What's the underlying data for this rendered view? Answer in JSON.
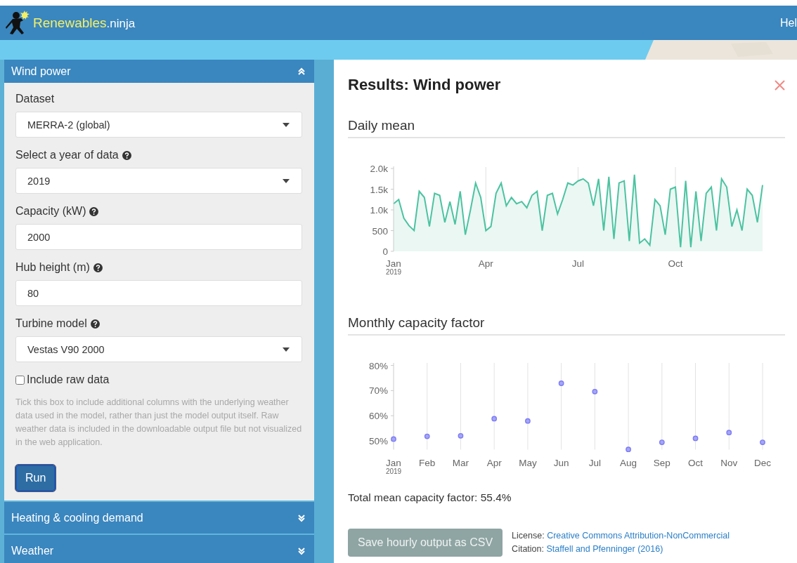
{
  "header": {
    "brand": "Renewables",
    "brand_suffix": ".ninja",
    "nav": [
      "Hel"
    ]
  },
  "sidebar": {
    "sections": [
      {
        "title": "Wind power",
        "expanded": true
      },
      {
        "title": "Heating & cooling demand",
        "expanded": false
      },
      {
        "title": "Weather",
        "expanded": false
      }
    ],
    "fields": [
      {
        "kind": "select",
        "label": "Dataset",
        "help": false,
        "value": "MERRA-2 (global)"
      },
      {
        "kind": "select",
        "label": "Select a year of data",
        "help": true,
        "value": "2019"
      },
      {
        "kind": "text",
        "label": "Capacity (kW)",
        "help": true,
        "value": "2000"
      },
      {
        "kind": "text",
        "label": "Hub height (m)",
        "help": true,
        "value": "80"
      },
      {
        "kind": "select",
        "label": "Turbine model",
        "help": true,
        "value": "Vestas V90 2000"
      }
    ],
    "checkbox": {
      "label": "Include raw data",
      "checked": false
    },
    "hint": "Tick this box to include additional columns with the underlying weather data used in the model, rather than just the model output itself. Raw weather data is included in the downloadable output file but not visualized in the web application.",
    "run_button": "Run"
  },
  "results": {
    "title": "Results: Wind power",
    "daily": {
      "title": "Daily mean",
      "year_label": "2019",
      "chart_data": {
        "type": "area",
        "grid": true,
        "categories": [
          "Jan",
          null,
          null,
          null,
          null,
          null,
          null,
          null,
          null,
          null,
          null,
          null,
          null,
          null,
          null,
          null,
          null,
          null,
          "Apr",
          null,
          null,
          null,
          null,
          null,
          null,
          null,
          null,
          null,
          null,
          null,
          null,
          null,
          null,
          null,
          null,
          null,
          "Jul",
          null,
          null,
          null,
          null,
          null,
          null,
          null,
          null,
          null,
          null,
          null,
          null,
          null,
          null,
          null,
          null,
          null,
          null,
          "Oct",
          null,
          null,
          null,
          null,
          null,
          null,
          null,
          null,
          null,
          null,
          null,
          null,
          null,
          null,
          null,
          null,
          null
        ],
        "values": [
          1150,
          1250,
          800,
          620,
          500,
          1450,
          1300,
          600,
          1400,
          1350,
          700,
          1200,
          650,
          1450,
          400,
          1000,
          1650,
          1300,
          500,
          600,
          1400,
          1650,
          1100,
          1300,
          1150,
          1200,
          1050,
          1350,
          1450,
          500,
          1350,
          1400,
          900,
          1250,
          1650,
          1600,
          1700,
          1750,
          1650,
          1100,
          1750,
          500,
          1800,
          300,
          1650,
          1700,
          250,
          1850,
          200,
          300,
          150,
          1250,
          1100,
          400,
          1500,
          1550,
          100,
          1700,
          100,
          1450,
          250,
          1400,
          1550,
          500,
          1750,
          1550,
          600,
          1000,
          500,
          1500,
          1350,
          700,
          1600
        ],
        "ylim": [
          0,
          2000
        ],
        "yticks": [
          {
            "value": 0,
            "label": "0"
          },
          {
            "value": 500,
            "label": "500"
          },
          {
            "value": 1000,
            "label": "1.0k"
          },
          {
            "value": 1500,
            "label": "1.5k"
          },
          {
            "value": 2000,
            "label": "2.0k"
          }
        ]
      }
    },
    "monthly": {
      "title": "Monthly capacity factor",
      "year_label": "2019",
      "chart_data": {
        "type": "scatter",
        "grid": true,
        "categories": [
          "Jan",
          "Feb",
          "Mar",
          "Apr",
          "May",
          "Jun",
          "Jul",
          "Aug",
          "Sep",
          "Oct",
          "Nov",
          "Dec"
        ],
        "values": [
          50.7,
          51.8,
          52.0,
          58.8,
          57.9,
          72.9,
          69.6,
          46.6,
          49.4,
          51.0,
          53.3,
          49.4
        ],
        "ylim": [
          46.5,
          81
        ],
        "yticks": [
          {
            "value": 50,
            "label": "50%"
          },
          {
            "value": 60,
            "label": "60%"
          },
          {
            "value": 70,
            "label": "70%"
          },
          {
            "value": 80,
            "label": "80%"
          }
        ]
      }
    },
    "total": "Total mean capacity factor: 55.4%",
    "save_button": {
      "label": "Save hourly output as CSV",
      "disabled": true
    },
    "license": {
      "label": "License:",
      "link": "Creative Commons Attribution-NonCommercial"
    },
    "citation": {
      "label": "Citation:",
      "link": "Staffell and Pfenninger (2016)"
    }
  }
}
